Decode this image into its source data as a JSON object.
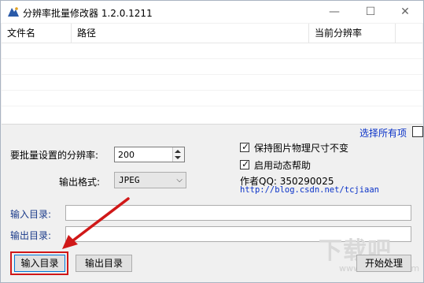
{
  "window": {
    "title": "分辨率批量修改器 1.2.0.1211",
    "controls": {
      "minimize": "—",
      "maximize": "☐",
      "close": "✕"
    }
  },
  "list": {
    "columns": [
      "文件名",
      "路径",
      "当前分辨率"
    ]
  },
  "select_all": "选择所有项",
  "resolution": {
    "label": "要批量设置的分辨率:",
    "value": "200"
  },
  "format": {
    "label": "输出格式:",
    "value": "JPEG"
  },
  "options": {
    "keep_size": {
      "label": "保持图片物理尺寸不变",
      "checked": true
    },
    "dynamic_help": {
      "label": "启用动态帮助",
      "checked": true
    }
  },
  "author": "作者QQ: 350290025",
  "url": "http://blog.csdn.net/tcjiaan",
  "input_dir": {
    "label": "输入目录:",
    "value": ""
  },
  "output_dir": {
    "label": "输出目录:",
    "value": ""
  },
  "buttons": {
    "input": "输入目录",
    "output": "输出目录",
    "start": "开始处理"
  },
  "annotation": {
    "highlight_color": "#d01818"
  },
  "watermark": {
    "logo": "下载吧",
    "sub": "www.xiazaiba.com"
  }
}
